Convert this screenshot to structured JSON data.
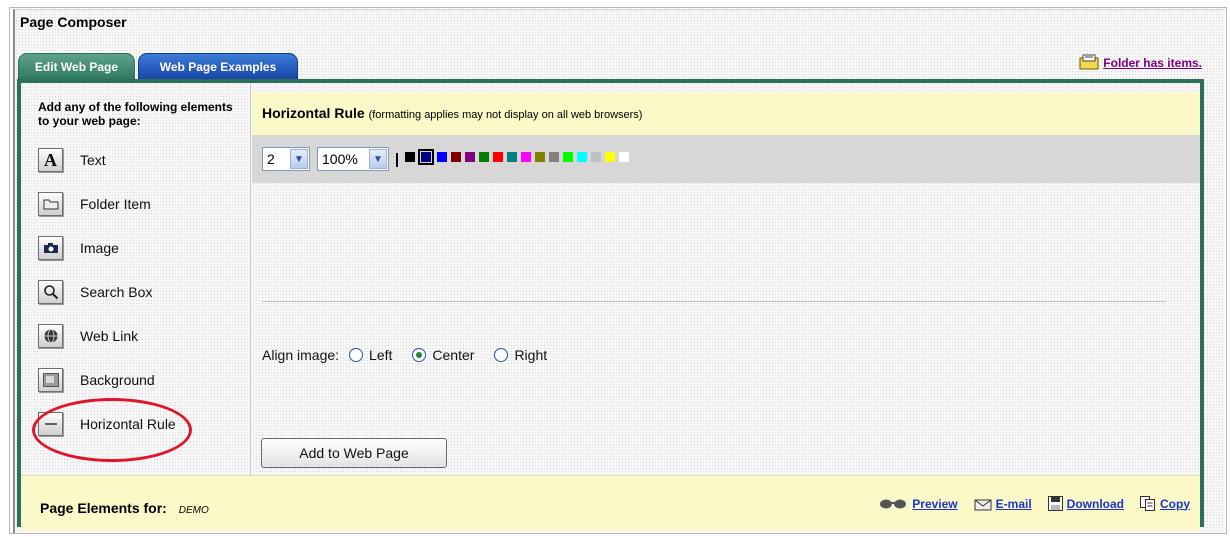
{
  "page_title": "Page Composer",
  "tabs": [
    {
      "label": "Edit Web Page",
      "active": true
    },
    {
      "label": "Web Page Examples",
      "active": false
    }
  ],
  "folder_note": "Folder has items.",
  "sidebar": {
    "intro": "Add any of the following elements to your web page:",
    "items": [
      {
        "label": "Text",
        "icon": "text-icon"
      },
      {
        "label": "Folder Item",
        "icon": "folder-icon"
      },
      {
        "label": "Image",
        "icon": "camera-icon"
      },
      {
        "label": "Search Box",
        "icon": "magnifier-icon"
      },
      {
        "label": "Web Link",
        "icon": "globe-link-icon"
      },
      {
        "label": "Background",
        "icon": "background-icon"
      },
      {
        "label": "Horizontal Rule",
        "icon": "horizontal-rule-icon"
      }
    ]
  },
  "editor": {
    "title": "Horizontal Rule",
    "note": "(formatting applies may not display on all web browsers)",
    "thickness_value": "2",
    "width_value": "100%",
    "colors": [
      "#000000",
      "#000080",
      "#0000ff",
      "#800000",
      "#800080",
      "#008000",
      "#ff0000",
      "#008080",
      "#ff00ff",
      "#808000",
      "#808080",
      "#00ff00",
      "#00ffff",
      "#c0c0c0",
      "#ffff00",
      "#ffffff"
    ],
    "selected_color": "#000080",
    "align_label": "Align image:",
    "align_options": [
      "Left",
      "Center",
      "Right"
    ],
    "align_selected": "Center",
    "add_button": "Add to Web Page"
  },
  "footer": {
    "label": "Page Elements for:",
    "user": "DEMO",
    "actions": [
      {
        "label": "Preview",
        "icon": "glasses-icon"
      },
      {
        "label": "E-mail",
        "icon": "envelope-icon"
      },
      {
        "label": "Download",
        "icon": "floppy-icon"
      },
      {
        "label": "Copy",
        "icon": "copy-icon"
      }
    ]
  },
  "colors": {
    "panel_border": "#2e6f5c",
    "header_bg": "#fcf9c8",
    "link": "#1a35c9",
    "highlight": "#e0142a"
  }
}
